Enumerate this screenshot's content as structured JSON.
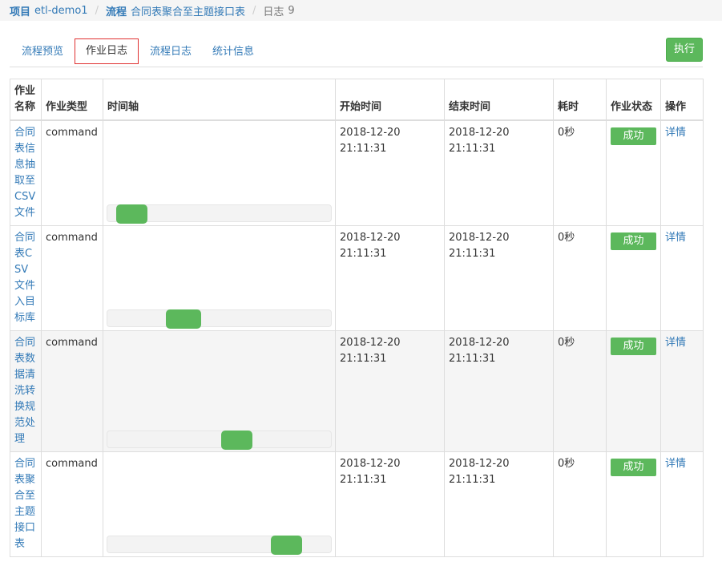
{
  "breadcrumb": {
    "project_label": "项目",
    "project_name": "etl-demo1",
    "flow_label": "流程",
    "flow_name": "合同表聚合至主题接口表",
    "log_label": "日志",
    "log_number": "9"
  },
  "tabs": [
    {
      "label": "流程预览",
      "active": false
    },
    {
      "label": "作业日志",
      "active": true
    },
    {
      "label": "流程日志",
      "active": false
    },
    {
      "label": "统计信息",
      "active": false
    }
  ],
  "execute_button": "执行",
  "table": {
    "headers": [
      "作业名称",
      "作业类型",
      "时间轴",
      "开始时间",
      "结束时间",
      "耗时",
      "作业状态",
      "操作"
    ],
    "rows": [
      {
        "name": "合同表信息抽取至CSV文件",
        "type": "command",
        "start_date": "2018-12-20",
        "start_time": "21:11:31",
        "end_date": "2018-12-20",
        "end_time": "21:11:31",
        "duration": "0秒",
        "status": "成功",
        "action": "详情",
        "timeline_start": 0.04,
        "timeline_width": 0.14
      },
      {
        "name": "合同表CSV文件入目标库",
        "type": "command",
        "start_date": "2018-12-20",
        "start_time": "21:11:31",
        "end_date": "2018-12-20",
        "end_time": "21:11:31",
        "duration": "0秒",
        "status": "成功",
        "action": "详情",
        "timeline_start": 0.26,
        "timeline_width": 0.16
      },
      {
        "name": "合同表数据清洗转换规范处理",
        "type": "command",
        "start_date": "2018-12-20",
        "start_time": "21:11:31",
        "end_date": "2018-12-20",
        "end_time": "21:11:31",
        "duration": "0秒",
        "status": "成功",
        "action": "详情",
        "timeline_start": 0.51,
        "timeline_width": 0.14
      },
      {
        "name": "合同表聚合至主题接口表",
        "type": "command",
        "start_date": "2018-12-20",
        "start_time": "21:11:31",
        "end_date": "2018-12-20",
        "end_time": "21:11:31",
        "duration": "0秒",
        "status": "成功",
        "action": "详情",
        "timeline_start": 0.73,
        "timeline_width": 0.14
      }
    ]
  },
  "colors": {
    "link": "#337ab7",
    "success": "#5cb85c",
    "active_tab_border": "#e03131"
  }
}
